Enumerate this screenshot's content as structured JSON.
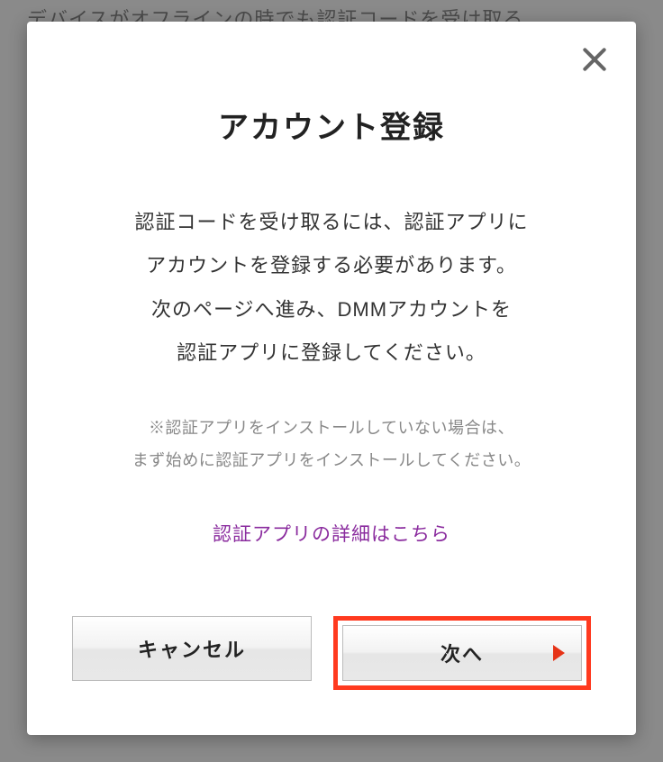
{
  "backdrop": {
    "text": "デバイスがオフラインの時でも認証コードを受け取る"
  },
  "modal": {
    "title": "アカウント登録",
    "body_line1": "認証コードを受け取るには、認証アプリに",
    "body_line2": "アカウントを登録する必要があります。",
    "body_line3": "次のページへ進み、DMMアカウントを",
    "body_line4": "認証アプリに登録してください。",
    "note_line1": "※認証アプリをインストールしていない場合は、",
    "note_line2": "まず始めに認証アプリをインストールしてください。",
    "link": "認証アプリの詳細はこちら",
    "cancel_label": "キャンセル",
    "next_label": "次へ"
  }
}
